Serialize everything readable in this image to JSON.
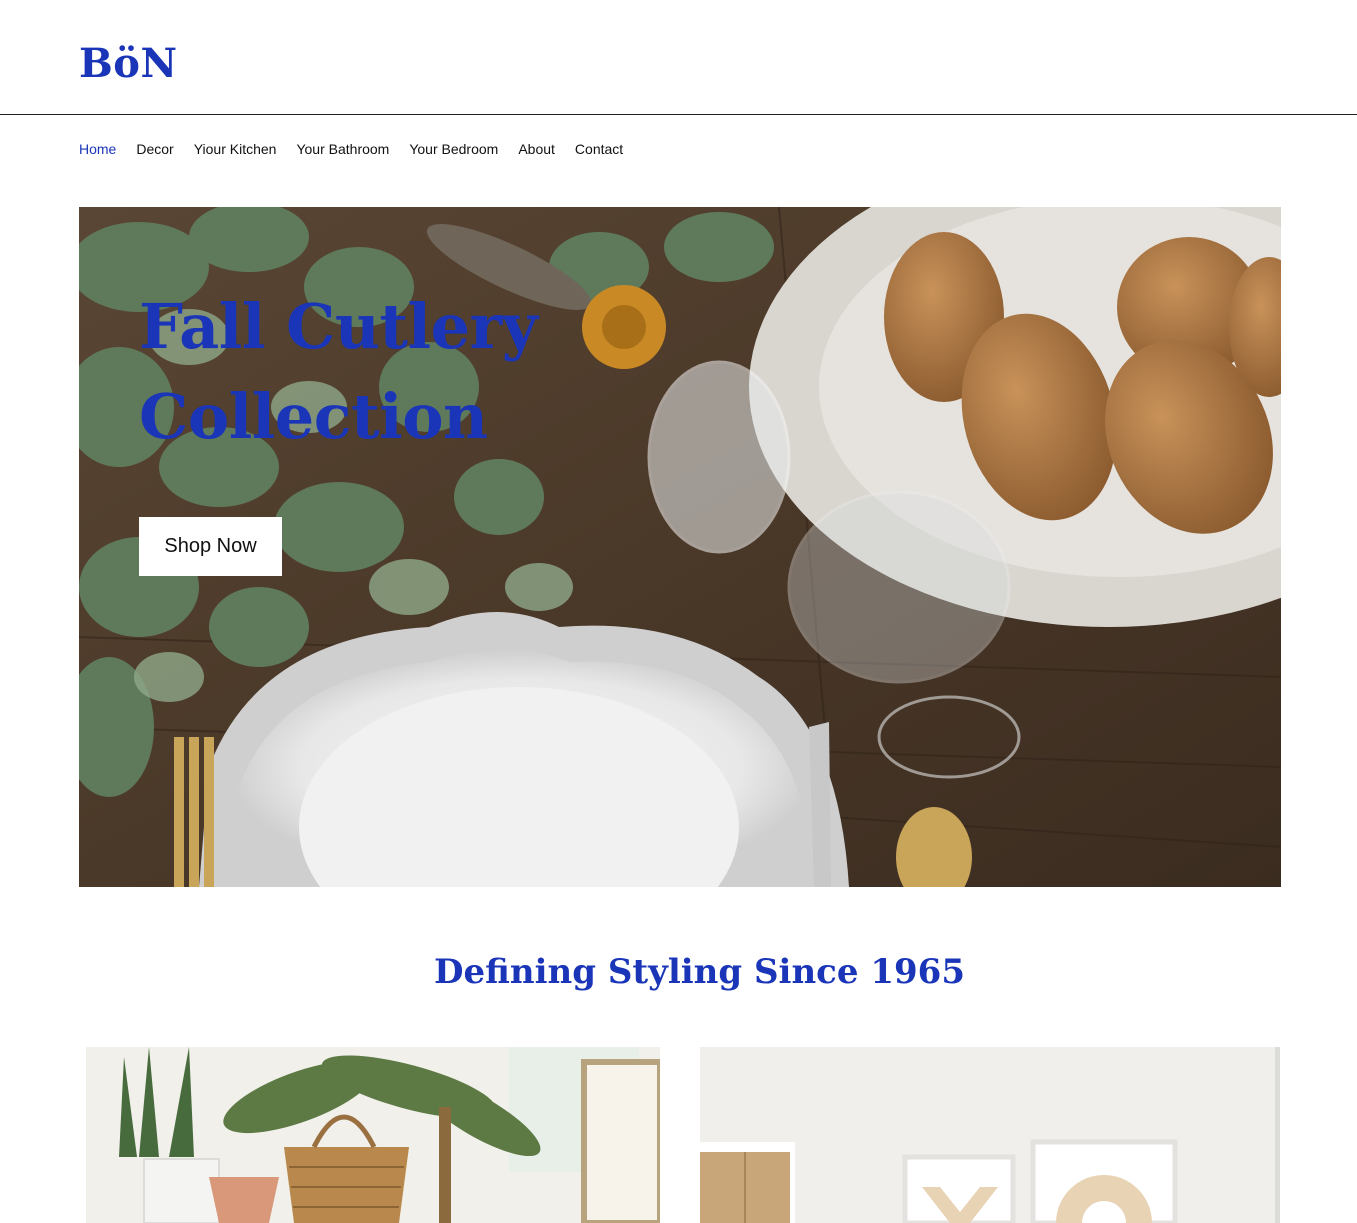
{
  "brand": {
    "logo": "BöN",
    "accent": "#1a35b8"
  },
  "nav": {
    "items": [
      {
        "label": "Home",
        "active": true
      },
      {
        "label": "Decor",
        "active": false
      },
      {
        "label": "Yiour Kitchen",
        "active": false
      },
      {
        "label": "Your Bathroom",
        "active": false
      },
      {
        "label": "Your Bedroom",
        "active": false
      },
      {
        "label": "About",
        "active": false
      },
      {
        "label": "Contact",
        "active": false
      }
    ]
  },
  "hero": {
    "title": "Fall Cutlery Collection",
    "cta_label": "Shop Now"
  },
  "section": {
    "title": "Defining Styling Since 1965"
  }
}
